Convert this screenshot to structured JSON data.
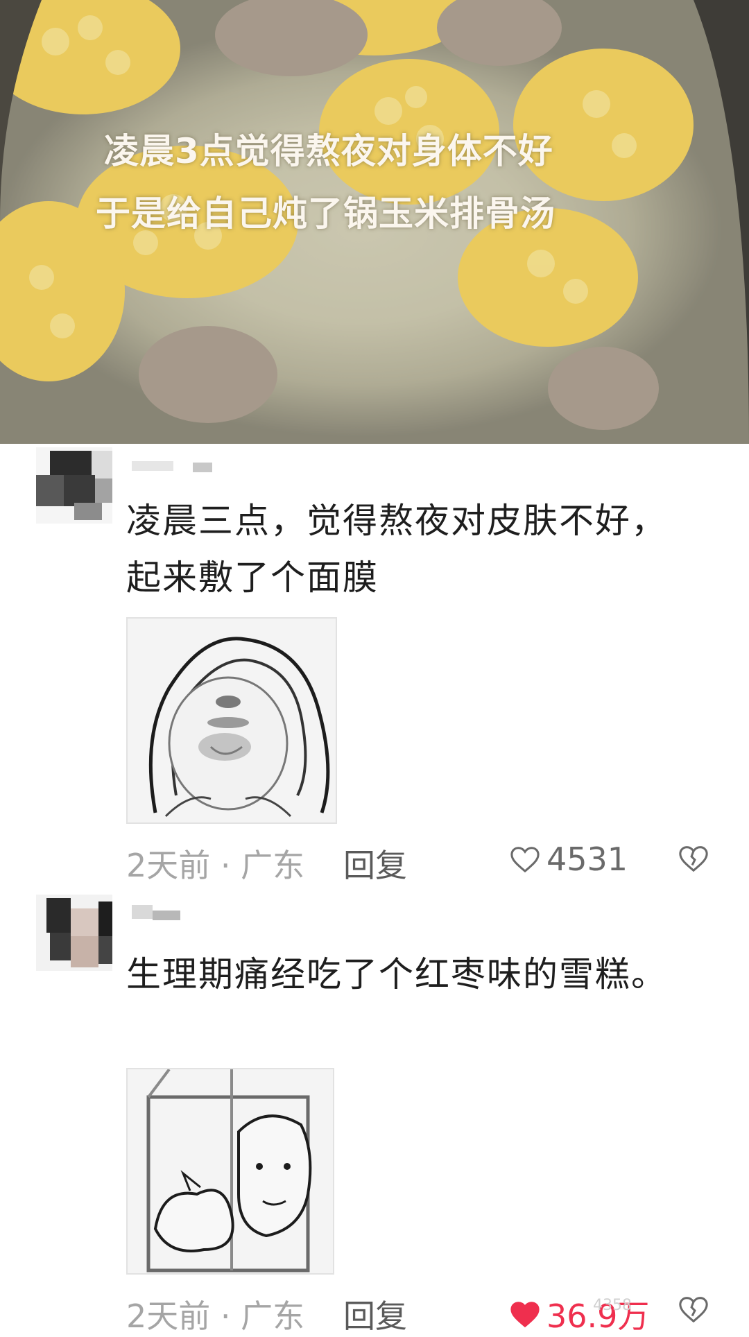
{
  "post": {
    "image_caption_line1": "凌晨3点觉得熬夜对身体不好",
    "image_caption_line2": "于是给自己炖了锅玉米排骨汤"
  },
  "comments": [
    {
      "text": "凌晨三点，觉得熬夜对皮肤不好，起来敷了个面膜",
      "time_location": "2天前 · 广东",
      "reply_label": "回复",
      "like_count": "4531",
      "liked": false,
      "sticker_icon": "face-mask-meme-sticker"
    },
    {
      "text": "生理期痛经吃了个红枣味的雪糕。",
      "time_location": "2天前 · 广东",
      "reply_label": "回复",
      "like_count": "36.9万",
      "liked": true,
      "sticker_icon": "cat-meme-sticker"
    }
  ],
  "watermark": "4358",
  "colors": {
    "like_active": "#ef2f4e",
    "meta_text": "#a5a5a5",
    "corn": "#f3c62a"
  }
}
